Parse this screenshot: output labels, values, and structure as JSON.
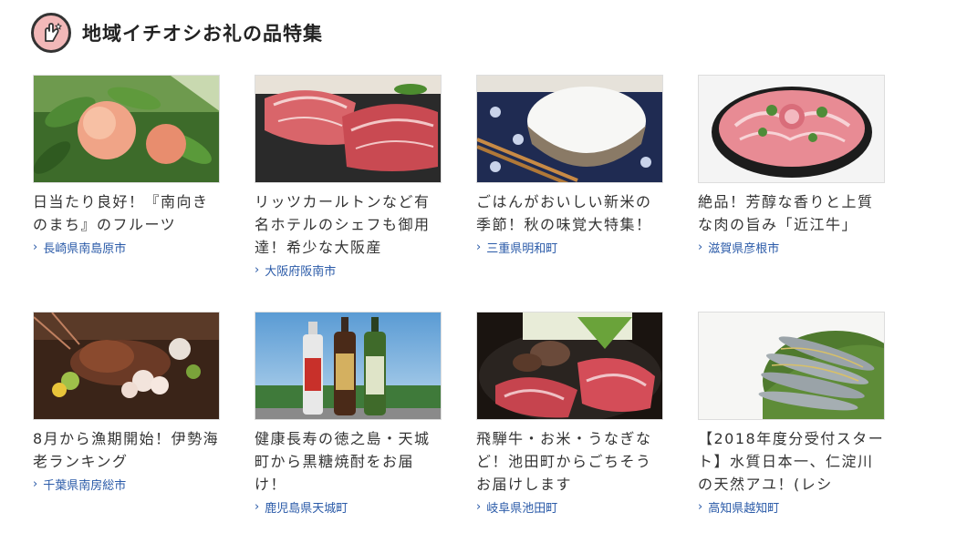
{
  "header": {
    "title": "地域イチオシお礼の品特集",
    "icon": "hand-heart-icon"
  },
  "cards": [
    {
      "text": "日当たり良好！『南向きのまち』のフルーツ",
      "location": "長崎県南島原市",
      "image": "peach-photo"
    },
    {
      "text": "リッツカールトンなど有名ホテルのシェフも御用達！希少な大阪産",
      "location": "大阪府阪南市",
      "image": "beef-steak-photo"
    },
    {
      "text": "ごはんがおいしい新米の季節！秋の味覚大特集！",
      "location": "三重県明和町",
      "image": "rice-bowl-photo"
    },
    {
      "text": "絶品！芳醇な香りと上質な肉の旨み「近江牛」",
      "location": "滋賀県彦根市",
      "image": "sliced-beef-photo"
    },
    {
      "text": "8月から漁期開始！伊勢海老ランキング",
      "location": "千葉県南房総市",
      "image": "lobster-photo"
    },
    {
      "text": "健康長寿の徳之島・天城町から黒糖焼酎をお届け！",
      "location": "鹿児島県天城町",
      "image": "shochu-bottles-photo"
    },
    {
      "text": "飛騨牛・お米・うなぎなど！池田町からごちそうお届けします",
      "location": "岐阜県池田町",
      "image": "sukiyaki-photo"
    },
    {
      "text": "【2018年度分受付スタート】水質日本一、仁淀川の天然アユ！(レシ",
      "location": "高知県越知町",
      "image": "ayu-fish-photo"
    }
  ],
  "colors": {
    "link": "#2a5aa8",
    "text": "#333333",
    "logo_bg": "#f2b8b8"
  }
}
